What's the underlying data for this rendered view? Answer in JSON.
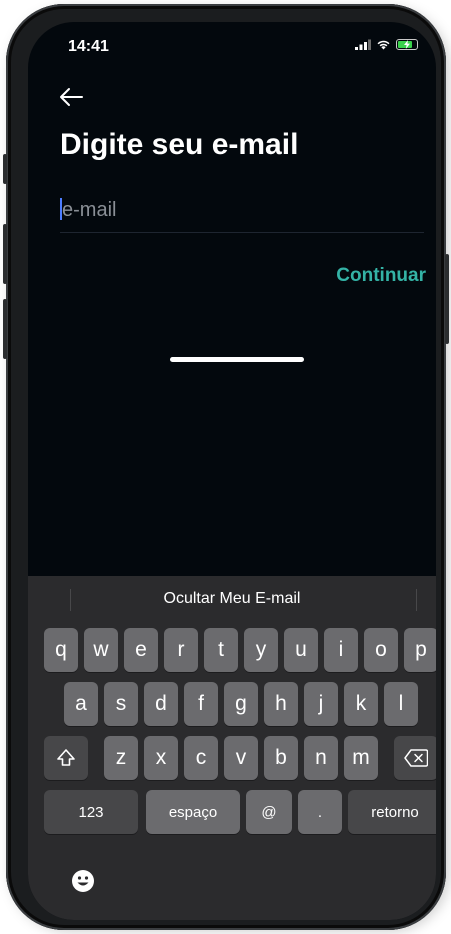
{
  "status_bar": {
    "time": "14:41",
    "icons": [
      "signal-icon",
      "wifi-icon",
      "battery-charging-icon"
    ],
    "battery_color": "#3ad14c"
  },
  "nav": {
    "back_icon": "arrow-left-icon"
  },
  "page": {
    "title": "Digite seu e-mail"
  },
  "email_field": {
    "placeholder": "e-mail",
    "value": ""
  },
  "continue_label": "Continuar",
  "accent_color": "#34b3a6",
  "keyboard": {
    "suggestion": "Ocultar Meu E-mail",
    "row1": [
      "q",
      "w",
      "e",
      "r",
      "t",
      "y",
      "u",
      "i",
      "o",
      "p"
    ],
    "row2": [
      "a",
      "s",
      "d",
      "f",
      "g",
      "h",
      "j",
      "k",
      "l"
    ],
    "row3": [
      "z",
      "x",
      "c",
      "v",
      "b",
      "n",
      "m"
    ],
    "shift_icon": "shift-icon",
    "delete_icon": "backspace-icon",
    "numbers_label": "123",
    "space_label": "espaço",
    "at_label": "@",
    "dot_label": ".",
    "return_label": "retorno",
    "emoji_icon": "emoji-icon"
  }
}
